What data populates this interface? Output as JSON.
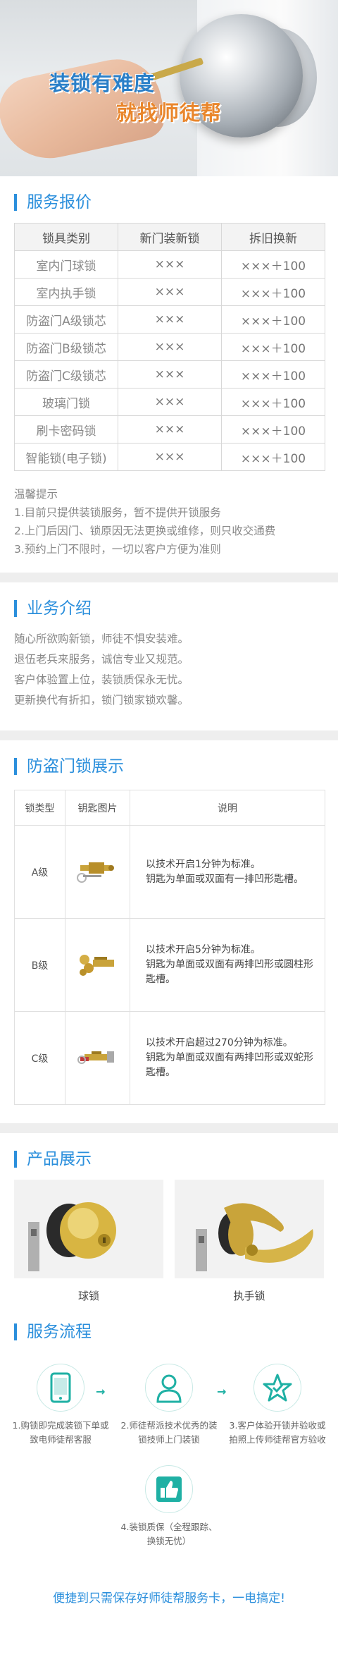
{
  "hero": {
    "line1": "装锁有难度",
    "line2": "就找师徒帮"
  },
  "pricing": {
    "title": "服务报价",
    "headers": [
      "锁具类别",
      "新门装新锁",
      "拆旧换新"
    ],
    "rows": [
      [
        "室内门球锁",
        "×××",
        "×××＋100"
      ],
      [
        "室内执手锁",
        "×××",
        "×××＋100"
      ],
      [
        "防盗门A级锁芯",
        "×××",
        "×××＋100"
      ],
      [
        "防盗门B级锁芯",
        "×××",
        "×××＋100"
      ],
      [
        "防盗门C级锁芯",
        "×××",
        "×××＋100"
      ],
      [
        "玻璃门锁",
        "×××",
        "×××＋100"
      ],
      [
        "刷卡密码锁",
        "×××",
        "×××＋100"
      ],
      [
        "智能锁(电子锁)",
        "×××",
        "×××＋100"
      ]
    ],
    "tips": [
      "温馨提示",
      "1.目前只提供装锁服务，暂不提供开锁服务",
      "2.上门后因门、锁原因无法更换或维修，则只收交通费",
      "3.预约上门不限时，一切以客户方便为准则"
    ]
  },
  "intro": {
    "title": "业务介绍",
    "lines": [
      "随心所欲购新锁，师徒不惧安装难。",
      "退伍老兵来服务，诚信专业又规范。",
      "客户体验置上位，装锁质保永无忧。",
      "更新换代有折扣，锁门锁家锁欢馨。"
    ]
  },
  "locks": {
    "title": "防盗门锁展示",
    "headers": [
      "锁类型",
      "钥匙图片",
      "说明"
    ],
    "rows": [
      {
        "level": "A级",
        "desc": "以技术开启1分钟为标准。\n钥匙为单面或双面有一排凹形匙槽。"
      },
      {
        "level": "B级",
        "desc": "以技术开启5分钟为标准。\n钥匙为单面或双面有两排凹形或圆柱形匙槽。"
      },
      {
        "level": "C级",
        "desc": "以技术开启超过270分钟为标准。\n钥匙为单面或双面有两排凹形或双蛇形匙槽。"
      }
    ]
  },
  "products": {
    "title": "产品展示",
    "items": [
      {
        "name": "球锁"
      },
      {
        "name": "执手锁"
      }
    ]
  },
  "flow": {
    "title": "服务流程",
    "steps": [
      {
        "label": "1.购锁即完成装锁下单或致电师徒帮客服",
        "icon": "phone-icon"
      },
      {
        "label": "2.师徒帮派技术优秀的装锁技师上门装锁",
        "icon": "technician-icon"
      },
      {
        "label": "3.客户体验开锁并验收或拍照上传师徒帮官方验收",
        "icon": "star-icon"
      },
      {
        "label": "4.装锁质保（全程跟踪、换锁无忧）",
        "icon": "thumbs-up-icon"
      }
    ],
    "footer": "便捷到只需保存好师徒帮服务卡，一电搞定!"
  },
  "colors": {
    "accent": "#2b8fdc",
    "teal": "#1fb0a4",
    "orange": "#e9862c"
  }
}
